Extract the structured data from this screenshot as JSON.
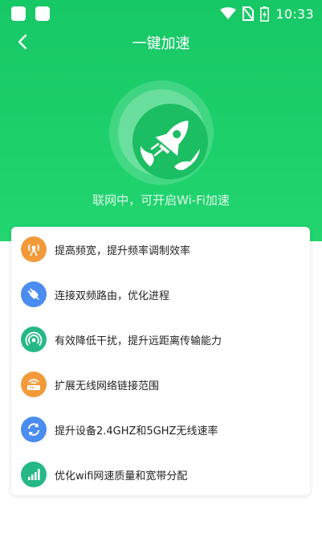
{
  "status_bar": {
    "time": "10:33"
  },
  "nav": {
    "title": "一键加速"
  },
  "hero": {
    "status_text": "联网中，可开启Wi-Fi加速"
  },
  "features": [
    {
      "label": "提高频宽，提升频率调制效率",
      "icon": "antenna-icon",
      "color": "#f29a3a"
    },
    {
      "label": "连接双频路由，优化进程",
      "icon": "plug-icon",
      "color": "#4a8cf0"
    },
    {
      "label": "有效降低干扰，提升远距离传输能力",
      "icon": "signal-waves-icon",
      "color": "#25b886"
    },
    {
      "label": "扩展无线网络链接范围",
      "icon": "router-icon",
      "color": "#f29a3a"
    },
    {
      "label": "提升设备2.4GHZ和5GHZ无线速率",
      "icon": "refresh-icon",
      "color": "#4a8cf0"
    },
    {
      "label": "优化wifi网速质量和宽带分配",
      "icon": "signal-bars-icon",
      "color": "#25b886"
    }
  ]
}
